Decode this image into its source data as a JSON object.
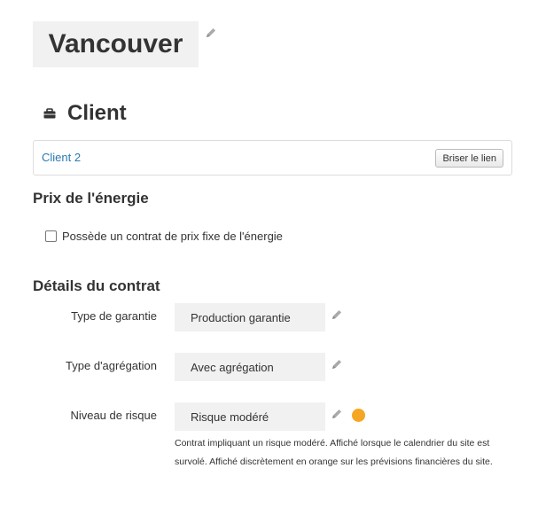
{
  "page": {
    "title": "Vancouver"
  },
  "client_section": {
    "heading": "Client",
    "client_link": "Client 2",
    "unlink_button": "Briser le lien"
  },
  "energy_section": {
    "heading": "Prix de l'énergie",
    "fixed_price_checkbox_label": "Possède un contrat de prix fixe de l'énergie",
    "fixed_price_checked": false
  },
  "contract_section": {
    "heading": "Détails du contrat",
    "fields": [
      {
        "label": "Type de garantie",
        "value": "Production garantie"
      },
      {
        "label": "Type d'agrégation",
        "value": "Avec agrégation"
      },
      {
        "label": "Niveau de risque",
        "value": "Risque modéré"
      }
    ],
    "risk_color": "#f5a623",
    "risk_description": "Contrat impliquant un risque modéré. Affiché lorsque le calendrier du site est survolé. Affiché discrètement en orange sur les prévisions financières du site."
  },
  "icons": {
    "edit": "pencil-icon",
    "client_section": "briefcase-icon"
  }
}
